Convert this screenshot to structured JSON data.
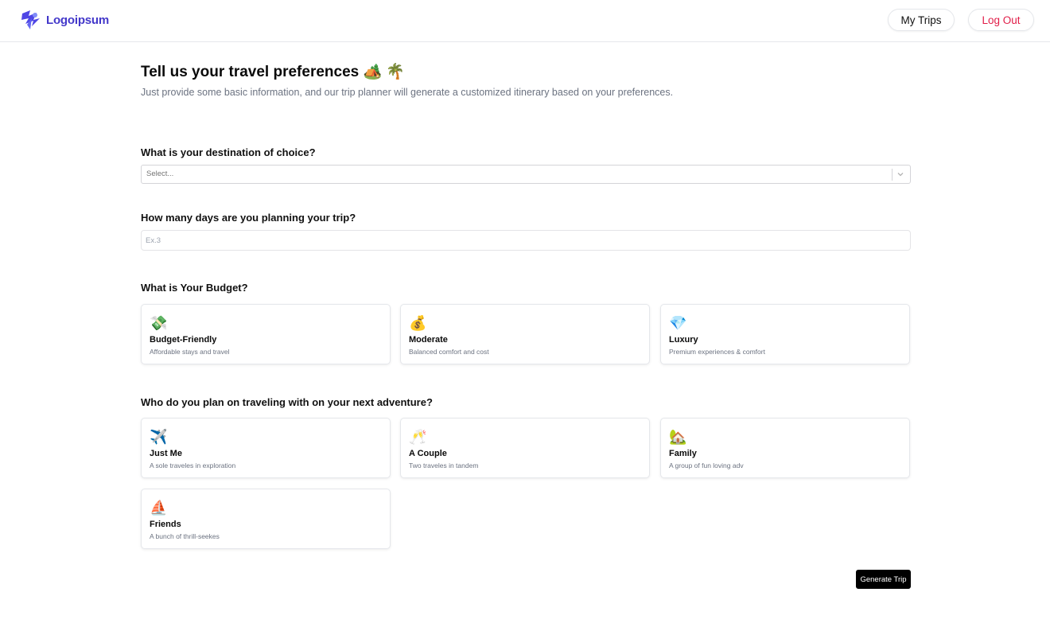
{
  "header": {
    "logo_text": "Logoipsum",
    "my_trips_label": "My Trips",
    "logout_label": "Log Out"
  },
  "intro": {
    "title": "Tell us your travel preferences 🏕️ 🌴",
    "subtitle": "Just provide some basic information, and our trip planner will generate a customized itinerary based on your preferences."
  },
  "destination": {
    "question": "What is your destination of choice?",
    "placeholder": "Select..."
  },
  "days": {
    "question": "How many days are you planning your trip?",
    "placeholder": "Ex.3"
  },
  "budget": {
    "question": "What is Your Budget?",
    "options": [
      {
        "icon": "💸",
        "title": "Budget-Friendly",
        "desc": "Affordable stays and travel"
      },
      {
        "icon": "💰",
        "title": "Moderate",
        "desc": "Balanced comfort and cost"
      },
      {
        "icon": "💎",
        "title": "Luxury",
        "desc": "Premium experiences & comfort"
      }
    ]
  },
  "travelers": {
    "question": "Who do you plan on traveling with on your next adventure?",
    "options": [
      {
        "icon": "✈️",
        "title": "Just Me",
        "desc": "A sole traveles in exploration"
      },
      {
        "icon": "🥂",
        "title": "A Couple",
        "desc": "Two traveles in tandem"
      },
      {
        "icon": "🏡",
        "title": "Family",
        "desc": "A group of fun loving adv"
      },
      {
        "icon": "⛵",
        "title": "Friends",
        "desc": "A bunch of thrill-seekes"
      }
    ]
  },
  "actions": {
    "generate_label": "Generate Trip"
  },
  "colors": {
    "brand": "#4338ca",
    "logout": "#e11d48",
    "primary_button": "#000000"
  }
}
